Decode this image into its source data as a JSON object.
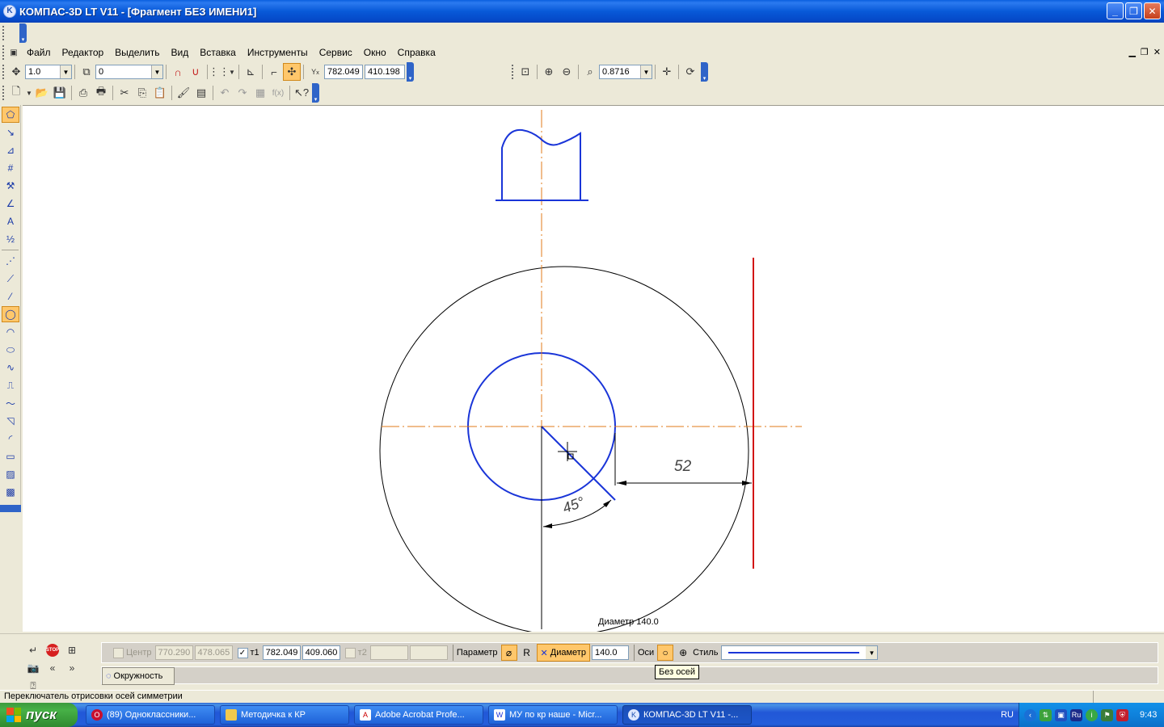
{
  "window": {
    "title": "КОМПАС-3D LT V11 - [Фрагмент БЕЗ ИМЕНИ1]",
    "minimize": "_",
    "restore": "❐",
    "close": "✕"
  },
  "menu": {
    "items": [
      "Файл",
      "Редактор",
      "Выделить",
      "Вид",
      "Вставка",
      "Инструменты",
      "Сервис",
      "Окно",
      "Справка"
    ]
  },
  "toolbar1": {
    "step": "1.0",
    "layer": "0",
    "coord_x": "782.049",
    "coord_y": "410.198",
    "zoom": "0.8716"
  },
  "drawing": {
    "dimension_52": "52",
    "angle_45": "45°",
    "diameter_label": "Диаметр 140.0"
  },
  "props": {
    "center_label": "Центр",
    "center_x": "770.290",
    "center_y": "478.065",
    "t1_label": "т1",
    "t1_x": "782.049",
    "t1_y": "409.060",
    "t2_label": "т2",
    "parameter_label": "Параметр",
    "r_label": "R",
    "diameter_label": "Диаметр",
    "diameter_value": "140.0",
    "axes_label": "Оси",
    "style_label": "Стиль",
    "tab_label": "Окружность",
    "tooltip": "Без осей"
  },
  "status": {
    "text": "Переключатель отрисовки осей симметрии"
  },
  "taskbar": {
    "start": "пуск",
    "tasks": [
      "(89) Одноклассники...",
      "Методичка к КР",
      "Adobe Acrobat Profe...",
      "МУ по кр наше - Micr...",
      "КОМПАС-3D LT V11 -..."
    ],
    "lang": "RU",
    "clock": "9:43"
  },
  "colors": {
    "blue_line": "#1a35d8",
    "axis_orange": "#e07b1a",
    "red_line": "#d21414"
  }
}
